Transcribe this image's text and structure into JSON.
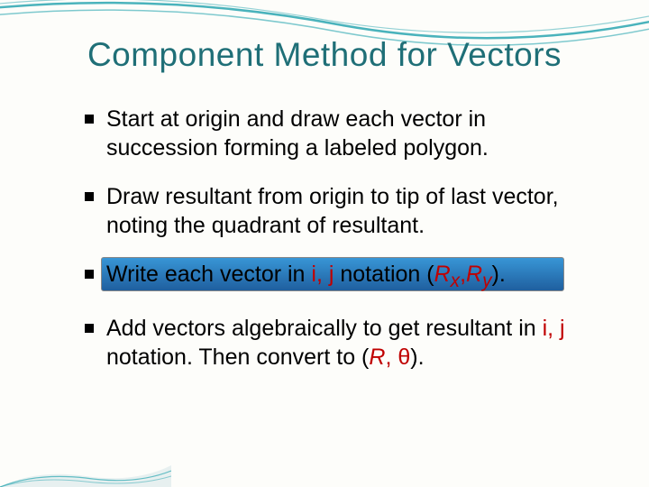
{
  "title": "Component Method for Vectors",
  "bullets": [
    {
      "pre": "Start at origin and draw each vector in succession forming a labeled polygon.",
      "red": "",
      "post": ""
    },
    {
      "pre": "Draw resultant from origin to tip of last vector, noting the quadrant of resultant.",
      "red": "",
      "post": ""
    },
    {
      "pre": "Write each vector in ",
      "red": "i, j",
      "post_a": " notation (",
      "rx": "R",
      "rxs": "x",
      "comma": ",",
      "ry": "R",
      "rys": "y",
      "post_b": ")."
    },
    {
      "pre": "Add vectors algebraically to get resultant in ",
      "red": "i, j",
      "post_a": " notation. Then convert to (",
      "r": "R",
      "comma": ", ",
      "theta": "θ",
      "post_b": ")."
    }
  ]
}
